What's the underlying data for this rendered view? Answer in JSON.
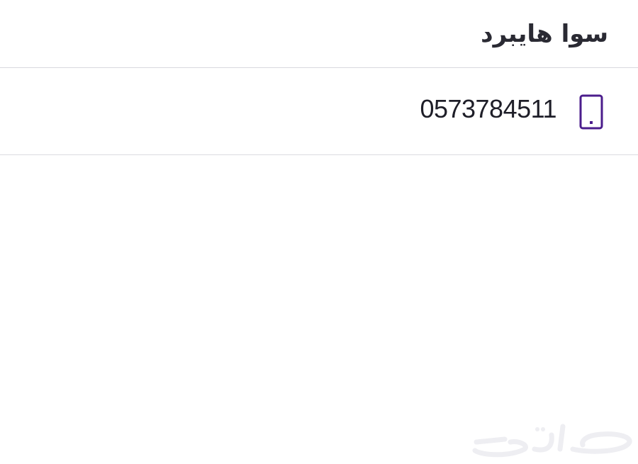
{
  "header": {
    "title": "سوا هايبرد"
  },
  "contact": {
    "icon": "phone-icon",
    "phone": "0573784511",
    "accent_color": "#4b1d8c"
  },
  "watermark": {
    "text": "حراج"
  }
}
